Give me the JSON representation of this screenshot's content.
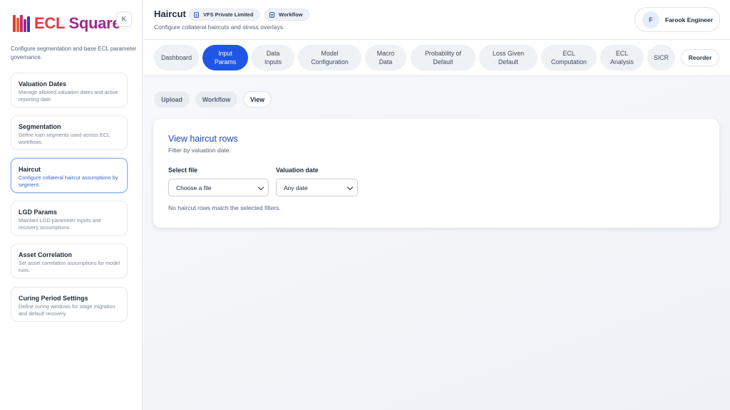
{
  "app": {
    "logo_text_a": "ECL",
    "logo_text_b": "Square",
    "brand_colors": {
      "primary": "#e03a3e",
      "secondary": "#a0288f",
      "accent": "#1f56e6"
    }
  },
  "sidebar": {
    "collapse_label": "K",
    "description": "Configure segmentation and base ECL parameter governance.",
    "items": [
      {
        "title": "Valuation Dates",
        "subtitle": "Manage allowed valuation dates and active reporting date."
      },
      {
        "title": "Segmentation",
        "subtitle": "Define loan segments used across ECL workflows."
      },
      {
        "title": "Haircut",
        "subtitle": "Configure collateral haircut assumptions by segment."
      },
      {
        "title": "LGD Params",
        "subtitle": "Maintain LGD parameter inputs and recovery assumptions."
      },
      {
        "title": "Asset Correlation",
        "subtitle": "Set asset correlation assumptions for model runs."
      },
      {
        "title": "Curing Period Settings",
        "subtitle": "Define curing windows for stage migration and default recovery."
      }
    ],
    "active_item": "Haircut"
  },
  "header": {
    "title": "Haircut",
    "company_badge": "VFS Private Limited",
    "workflow_badge": "Workflow",
    "subtitle": "Configure collateral haircuts and stress overlays.",
    "user": {
      "initial": "F",
      "name": "Farook Engineer"
    }
  },
  "tabs": {
    "items": [
      {
        "line1": "Dashboard",
        "line2": ""
      },
      {
        "line1": "Input",
        "line2": "Params"
      },
      {
        "line1": "Data",
        "line2": "Inputs"
      },
      {
        "line1": "Model",
        "line2": "Configuration"
      },
      {
        "line1": "Macro",
        "line2": "Data"
      },
      {
        "line1": "Probability of",
        "line2": "Default"
      },
      {
        "line1": "Loss Given",
        "line2": "Default"
      },
      {
        "line1": "ECL",
        "line2": "Computation"
      },
      {
        "line1": "ECL",
        "line2": "Analysis"
      },
      {
        "line1": "SICR",
        "line2": ""
      }
    ],
    "active": "Input Params",
    "reorder_label": "Reorder"
  },
  "subtabs": {
    "items": [
      "Upload",
      "Workflow",
      "View"
    ],
    "active": "View"
  },
  "view_card": {
    "title": "View haircut rows",
    "subtitle": "Filter by valuation date.",
    "file_label": "Select file",
    "file_value": "Choose a file",
    "date_label": "Valuation date",
    "date_value": "Any date",
    "empty_message": "No haircut rows match the selected filters."
  }
}
